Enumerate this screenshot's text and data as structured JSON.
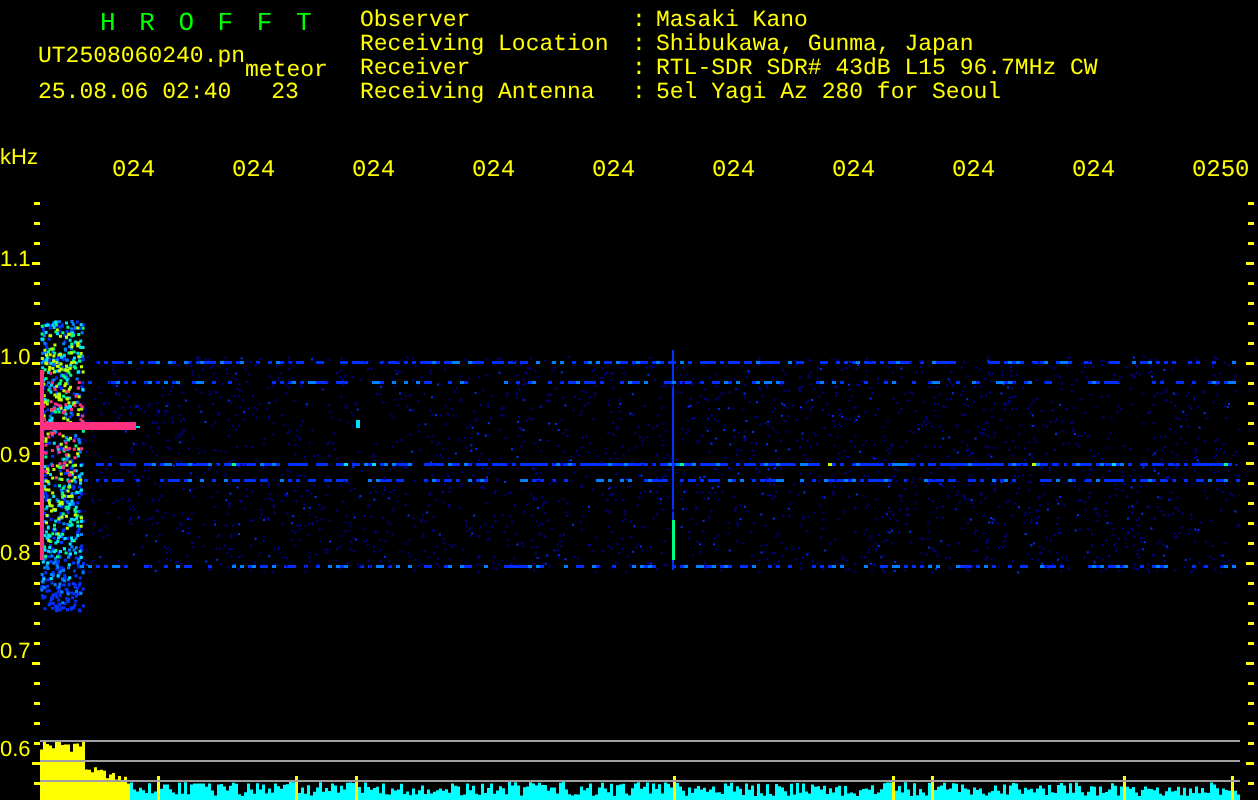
{
  "header": {
    "title": "H R O F F T",
    "file_name": "UT2508060240.pn",
    "type": "meteor",
    "timestamp": "25.08.06 02:40",
    "count": "23"
  },
  "info": [
    {
      "label": "Observer",
      "separator": ":",
      "value": "Masaki Kano"
    },
    {
      "label": "Receiving Location",
      "separator": ":",
      "value": "Shibukawa, Gunma, Japan"
    },
    {
      "label": "Receiver",
      "separator": ":",
      "value": "RTL-SDR SDR# 43dB L15 96.7MHz CW"
    },
    {
      "label": "Receiving Antenna",
      "separator": ":",
      "value": "5el Yagi Az 280 for Seoul"
    }
  ],
  "x_axis": {
    "labels": [
      "024",
      "024",
      "024",
      "024",
      "024",
      "024",
      "024",
      "024",
      "024",
      "0250"
    ]
  },
  "y_axis": {
    "unit": "kHz",
    "labels": [
      "1.1",
      "1.0",
      "0.9",
      "0.8",
      "0.7",
      "0.6"
    ]
  }
}
